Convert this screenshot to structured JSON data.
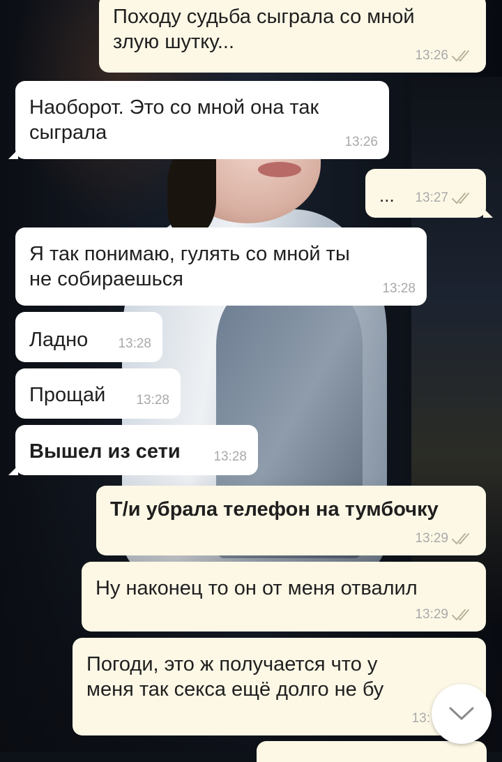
{
  "messages": [
    {
      "id": 1,
      "direction": "out",
      "lines": [
        "Походу судьба сыграла со мной",
        "злую шутку..."
      ],
      "time": "13:26",
      "read": true
    },
    {
      "id": 2,
      "direction": "in",
      "lines": [
        "Наоборот. Это со мной она так",
        "сыграла"
      ],
      "time": "13:26"
    },
    {
      "id": 3,
      "direction": "out",
      "lines": [
        "..."
      ],
      "time": "13:27",
      "read": true
    },
    {
      "id": 4,
      "direction": "in",
      "lines": [
        "Я так понимаю, гулять со мной ты",
        "не собираешься"
      ],
      "time": "13:28"
    },
    {
      "id": 5,
      "direction": "in",
      "lines": [
        "Ладно"
      ],
      "time": "13:28"
    },
    {
      "id": 6,
      "direction": "in",
      "lines": [
        "Прощай"
      ],
      "time": "13:28"
    },
    {
      "id": 7,
      "direction": "in",
      "lines": [
        "Вышел из сети"
      ],
      "time": "13:28",
      "bold": true
    },
    {
      "id": 8,
      "direction": "out",
      "lines": [
        "Т/и убрала телефон на тумбочку"
      ],
      "time": "13:29",
      "read": true,
      "bold": true
    },
    {
      "id": 9,
      "direction": "out",
      "lines": [
        "Ну наконец то он от меня отвалил"
      ],
      "time": "13:29",
      "read": true
    },
    {
      "id": 10,
      "direction": "out",
      "lines": [
        "Погоди, это ж получается что у",
        "меня так секса ещё долго не бу"
      ],
      "time": "13:",
      "read": true
    }
  ],
  "icons": {
    "read_receipt": "double-check-icon",
    "scroll_down": "chevron-down-icon"
  },
  "colors": {
    "incoming_bubble": "#ffffff",
    "outgoing_bubble": "#fdf8e6",
    "time_text": "#a9a9a9",
    "check_color": "#b9b39a"
  }
}
